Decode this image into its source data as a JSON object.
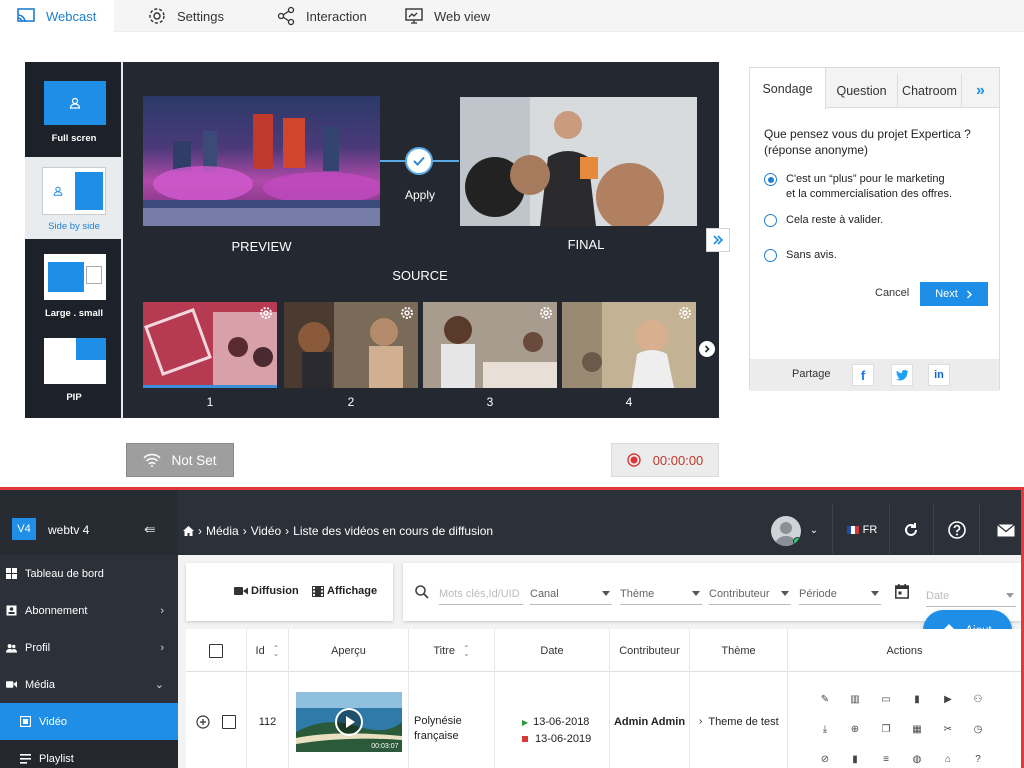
{
  "top_tabs": [
    {
      "label": "Webcast",
      "icon": "cast-icon",
      "active": true
    },
    {
      "label": "Settings",
      "icon": "gear-icon"
    },
    {
      "label": "Interaction",
      "icon": "share-icon"
    },
    {
      "label": "Web view",
      "icon": "monitor-icon"
    }
  ],
  "layouts": [
    {
      "label": "Full scren"
    },
    {
      "label": "Side by side",
      "selected": true
    },
    {
      "label": "Large . small"
    },
    {
      "label": "PIP"
    }
  ],
  "stage": {
    "preview_label": "PREVIEW",
    "final_label": "FINAL",
    "apply_label": "Apply",
    "source_label": "SOURCE",
    "sources": [
      "1",
      "2",
      "3",
      "4"
    ]
  },
  "panel": {
    "tabs": [
      "Sondage",
      "Question",
      "Chatroom"
    ],
    "more_label": "»",
    "question": "Que pensez vous du projet Expertica ? (réponse anonyme)",
    "options": [
      {
        "line1": "C'est un “plus” pour le marketing",
        "line2": "et la commercialisation des offres.",
        "checked": true
      },
      {
        "line1": "Cela reste à valider.",
        "line2": ""
      },
      {
        "line1": "Sans avis.",
        "line2": ""
      }
    ],
    "cancel_label": "Cancel",
    "next_label": "Next",
    "share_label": "Partage",
    "share_buttons": [
      "f",
      "t",
      "in"
    ]
  },
  "controls": {
    "not_set_label": "Not Set",
    "timer": "00:00:00"
  },
  "admin": {
    "badge": "V4",
    "brand": "webtv 4",
    "collapse_glyph": "⇚",
    "breadcrumb": [
      "Média",
      "Vidéo",
      "Liste des vidéos en cours de diffusion"
    ],
    "language": "FR",
    "sidebar": [
      {
        "label": "Tableau de bord",
        "chevron": ""
      },
      {
        "label": "Abonnement",
        "chevron": "›"
      },
      {
        "label": "Profil",
        "chevron": "›"
      },
      {
        "label": "Média",
        "chevron": "⌄"
      },
      {
        "label": "Vidéo",
        "chevron": "",
        "sub": true,
        "active": true
      },
      {
        "label": "Playlist",
        "chevron": "",
        "sub": true
      }
    ],
    "toolbar": {
      "diffusion": "Diffusion",
      "affichage": "Affichage"
    },
    "filters": {
      "search_placeholder": "Mots clés,Id/UID",
      "canal": "Canal",
      "theme": "Thème",
      "contributeur": "Contributeur",
      "periode": "Période",
      "date": "Date"
    },
    "ajout_label": "Ajout",
    "columns": [
      "Id",
      "Aperçu",
      "Titre",
      "Date",
      "Contributeur",
      "Thème",
      "Actions"
    ],
    "row": {
      "id": "112",
      "duration": "00:03:07",
      "title_line1": "Polynésie",
      "title_line2": "française",
      "date_start": "13-06-2018",
      "date_end": "13-06-2019",
      "contributor": "Admin Admin",
      "theme": "Theme de test"
    }
  },
  "colors": {
    "accent": "#1e8ee6",
    "stage_bg": "#232831",
    "admin_nav": "#2c3038",
    "frame_border": "#e03a3a"
  }
}
